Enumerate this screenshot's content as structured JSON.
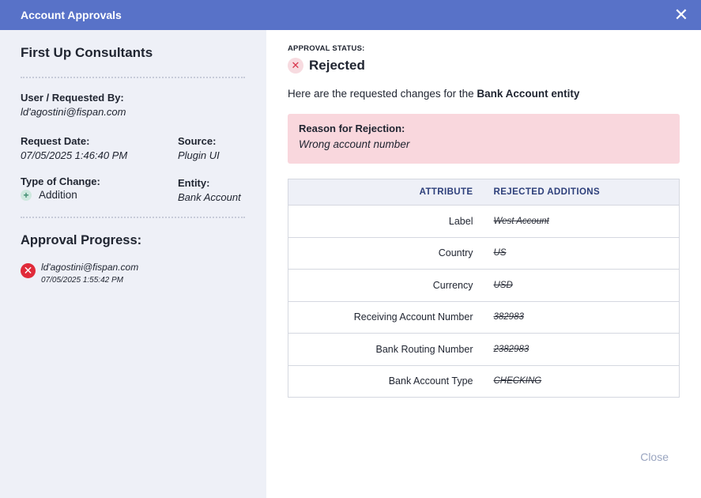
{
  "dialog": {
    "title": "Account Approvals",
    "close_icon": "close-icon"
  },
  "details": {
    "company": "First Up Consultants",
    "requested_by_label": "User / Requested By:",
    "requested_by": "ld'agostini@fispan.com",
    "request_date_label": "Request Date:",
    "request_date": "07/05/2025 1:46:40 PM",
    "source_label": "Source:",
    "source": "Plugin UI",
    "change_type_label": "Type of Change:",
    "change_type": "Addition",
    "entity_label": "Entity:",
    "entity": "Bank Account"
  },
  "progress": {
    "title": "Approval Progress:",
    "items": [
      {
        "email": "ld'agostini@fispan.com",
        "time": "07/05/2025 1:55:42 PM",
        "status": "rejected"
      }
    ]
  },
  "status": {
    "label": "APPROVAL STATUS:",
    "value": "Rejected"
  },
  "intro": {
    "prefix": "Here are the requested changes for the ",
    "entity": "Bank Account entity"
  },
  "reason": {
    "title": "Reason for Rejection:",
    "text": "Wrong account number"
  },
  "table": {
    "headers": [
      "ATTRIBUTE",
      "REJECTED ADDITIONS"
    ],
    "rows": [
      {
        "attribute": "Label",
        "value": "West Account"
      },
      {
        "attribute": "Country",
        "value": "US"
      },
      {
        "attribute": "Currency",
        "value": "USD"
      },
      {
        "attribute": "Receiving Account Number",
        "value": "382983"
      },
      {
        "attribute": "Bank Routing Number",
        "value": "2382983"
      },
      {
        "attribute": "Bank Account Type",
        "value": "CHECKING"
      }
    ]
  },
  "footer": {
    "close_label": "Close"
  },
  "colors": {
    "header": "#5872c8",
    "reject": "#e02a3a",
    "reason_bg": "#f9d7dd"
  }
}
